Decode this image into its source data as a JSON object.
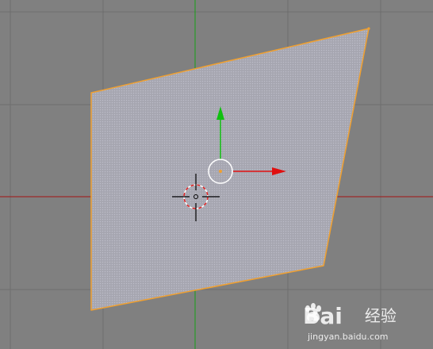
{
  "viewport": {
    "background_color": "#808080",
    "grid_color": "#6e6e6e",
    "x_axis_color": "#a31515",
    "y_axis_color": "#16a016"
  },
  "mesh": {
    "face_color": "#a9a9b4",
    "edge_color": "#f0a030",
    "selected": true
  },
  "gizmo": {
    "x_arrow_color": "#e01010",
    "y_arrow_color": "#10c010",
    "center_ring_color": "#ffffff",
    "origin_color": "#f0a030"
  },
  "cursor_3d": {
    "ring_colors": [
      "#e02020",
      "#ffffff"
    ],
    "crosshair_color": "#000000",
    "icon": "3d-cursor-icon"
  },
  "watermark": {
    "brand": "Bai",
    "brand_suffix": "经验",
    "url": "jingyan.baidu.com",
    "icon": "baidu-paw-icon"
  }
}
